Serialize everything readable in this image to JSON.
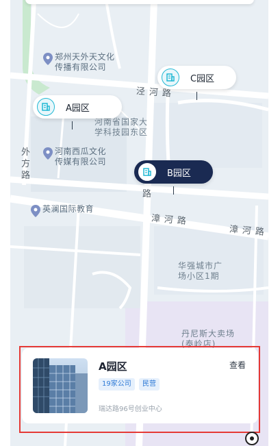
{
  "map": {
    "pois": [
      {
        "name": "poi-zhengzhou-tianwai",
        "lines": [
          "郑州天外天文化",
          "传播有限公司"
        ],
        "pin": true
      },
      {
        "name": "poi-henan-university-park",
        "lines": [
          "河南省国家大",
          "学科技园东区"
        ],
        "pin": false
      },
      {
        "name": "poi-henan-xigua",
        "lines": [
          "河南西瓜文化",
          "传媒有限公司"
        ],
        "pin": true
      },
      {
        "name": "poi-yinglan-education",
        "lines": [
          "英澜国际教育"
        ],
        "pin": true
      },
      {
        "name": "poi-huaqiang-plaza",
        "lines": [
          "华强城市广",
          "场小区1期"
        ],
        "pin": false
      },
      {
        "name": "poi-danisi-store",
        "lines": [
          "丹尼斯大卖场",
          "(泰岭店)"
        ],
        "pin": false
      }
    ],
    "roads": {
      "jinghe": "泾河路",
      "zhanghe_1": "漳河路",
      "zhanghe_2": "漳河路",
      "waifang": [
        "外",
        "方",
        "路"
      ],
      "lu_fragment": "路"
    },
    "parks": [
      {
        "name": "park-marker-a",
        "label": "A园区",
        "active": false
      },
      {
        "name": "park-marker-b",
        "label": "B园区",
        "active": true
      },
      {
        "name": "park-marker-c",
        "label": "C园区",
        "active": false
      }
    ]
  },
  "card": {
    "title": "A园区",
    "view_label": "查看",
    "tags": [
      "19家公司",
      "民营"
    ],
    "address": "瑞达路96号创业中心"
  },
  "colors": {
    "accent": "#21b8d4",
    "active_marker": "#1a2a52",
    "highlight_border": "#e53935",
    "tag_bg": "#e6f0fc",
    "tag_text": "#2f7ad6"
  }
}
